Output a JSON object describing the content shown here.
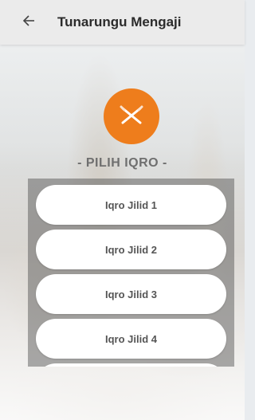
{
  "app_bar": {
    "title": "Tunarungu Mengaji",
    "back_icon": "arrow-left-icon"
  },
  "logo": {
    "icon": "crossed-pens-icon",
    "color": "#ee7d1c"
  },
  "heading": "- PILIH IQRO -",
  "list": {
    "items": [
      {
        "label": "Iqro Jilid 1"
      },
      {
        "label": "Iqro Jilid 2"
      },
      {
        "label": "Iqro Jilid 3"
      },
      {
        "label": "Iqro Jilid 4"
      },
      {
        "label": ""
      }
    ]
  }
}
